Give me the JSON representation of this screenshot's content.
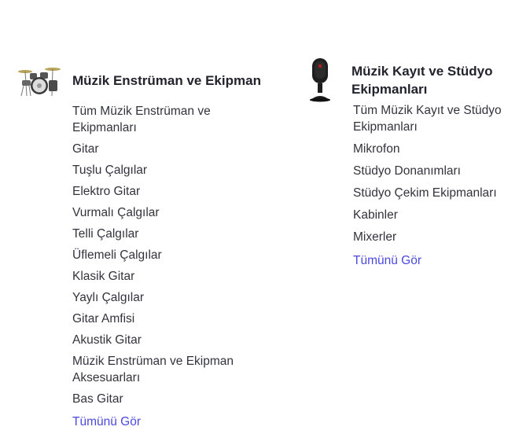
{
  "categories": [
    {
      "title": "Müzik Enstrüman ve Ekipman",
      "icon": "drum-kit-icon",
      "items": [
        "Tüm Müzik Enstrüman ve Ekipmanları",
        "Gitar",
        "Tuşlu Çalgılar",
        "Elektro Gitar",
        "Vurmalı Çalgılar",
        "Telli Çalgılar",
        "Üflemeli Çalgılar",
        "Klasik Gitar",
        "Yaylı Çalgılar",
        "Gitar Amfisi",
        "Akustik Gitar",
        "Müzik Enstrüman ve Ekipman Aksesuarları",
        "Bas Gitar"
      ],
      "see_all": "Tümünü Gör"
    },
    {
      "title": "Müzik Kayıt ve Stüdyo Ekipmanları",
      "icon": "microphone-icon",
      "items": [
        "Tüm Müzik Kayıt ve Stüdyo Ekipmanları",
        "Mikrofon",
        "Stüdyo Donanımları",
        "Stüdyo Çekim Ekipmanları",
        "Kabinler",
        "Mixerler"
      ],
      "see_all": "Tümünü Gör"
    }
  ],
  "colors": {
    "text": "#33333d",
    "title": "#23232d",
    "link_accent": "#4a49e0"
  }
}
